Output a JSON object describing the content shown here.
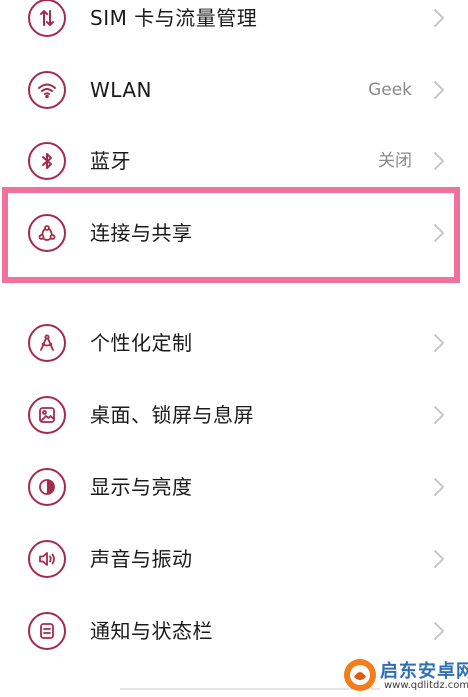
{
  "settings": {
    "items": [
      {
        "label": "SIM 卡与流量管理",
        "value": "",
        "icon": "sim-data-icon"
      },
      {
        "label": "WLAN",
        "value": "Geek",
        "icon": "wifi-icon"
      },
      {
        "label": "蓝牙",
        "value": "关闭",
        "icon": "bluetooth-icon"
      },
      {
        "label": "连接与共享",
        "value": "",
        "icon": "connection-sharing-icon"
      },
      {
        "label": "个性化定制",
        "value": "",
        "icon": "personalization-icon"
      },
      {
        "label": "桌面、锁屏与息屏",
        "value": "",
        "icon": "wallpaper-icon"
      },
      {
        "label": "显示与亮度",
        "value": "",
        "icon": "display-brightness-icon"
      },
      {
        "label": "声音与振动",
        "value": "",
        "icon": "sound-icon"
      },
      {
        "label": "通知与状态栏",
        "value": "",
        "icon": "notification-icon"
      }
    ]
  },
  "colors": {
    "icon_accent": "#a52a4e",
    "highlight_border": "#f0719c",
    "chevron": "#c8c8c8",
    "value_text": "#8a8a8a"
  },
  "watermark": {
    "title": "启东安卓网",
    "url": "www.qdlitdz.com"
  }
}
